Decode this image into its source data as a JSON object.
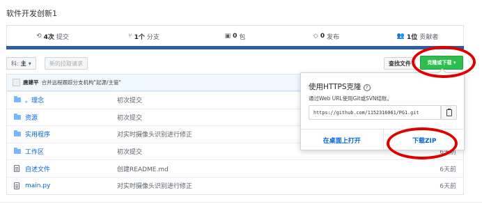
{
  "repo": {
    "title": "软件开发创新1"
  },
  "stats": [
    {
      "icon": "commits-icon",
      "glyph": "⟲",
      "count": "4次",
      "label": "提交"
    },
    {
      "icon": "branch-icon",
      "glyph": "⑂",
      "count": "1个",
      "label": "分支"
    },
    {
      "icon": "package-icon",
      "glyph": "▣",
      "count": "0",
      "label": "包"
    },
    {
      "icon": "tag-icon",
      "glyph": "◇",
      "count": "0",
      "label": "发布"
    },
    {
      "icon": "contributors-icon",
      "glyph": "👥",
      "count": "1位",
      "label": "贡献者"
    }
  ],
  "toolbar": {
    "branch_prefix": "科:",
    "branch_name": "主",
    "new_pr": "新的拉取请求",
    "find_file": "查找文件",
    "clone_download": "克隆或下载 ▾"
  },
  "commit": {
    "author": "唐建平",
    "message": "合并远程跟踪分支机构\"起源/主管\""
  },
  "files": [
    {
      "type": "dir",
      "name": "。理念",
      "message": "初次提交",
      "age": ""
    },
    {
      "type": "dir",
      "name": "资源",
      "message": "初次提交",
      "age": ""
    },
    {
      "type": "dir",
      "name": "实用程序",
      "message": "对实时摄像头识别进行修正",
      "age": ""
    },
    {
      "type": "dir",
      "name": "工作区",
      "message": "初次提交",
      "age": "6天前"
    },
    {
      "type": "file",
      "name": "自述文件",
      "message": "创建README.md",
      "age": "6天前"
    },
    {
      "type": "file",
      "name": "main.py",
      "message": "对实时摄像头识别进行修正",
      "age": "6天前"
    }
  ],
  "clone_popup": {
    "title": "使用HTTPS克隆",
    "help": "?",
    "description": "通过Web URL使用Git或SVN结账。",
    "url": "https://github.com/1152316061/PG1.git",
    "open_desktop": "在桌面上打开",
    "download_zip": "下载ZIP"
  },
  "colors": {
    "accent_green": "#2cbe4e",
    "link_blue": "#0366d6",
    "annotation_red": "#e00000"
  }
}
